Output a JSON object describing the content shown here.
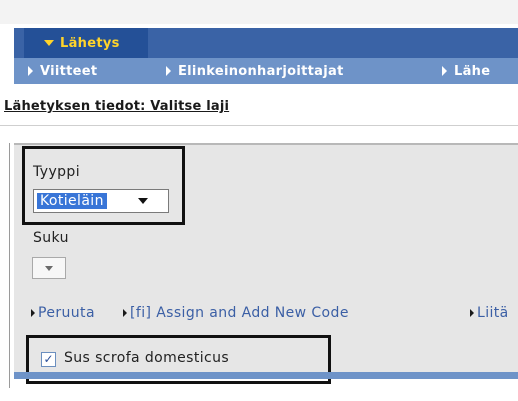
{
  "menu": {
    "active_label": "Lähetys",
    "sub_items": [
      "Viitteet",
      "Elinkeinonharjoittajat",
      "Lähe"
    ]
  },
  "section": {
    "title": "Lähetyksen tiedot: Valitse laji"
  },
  "form": {
    "tyyppi": {
      "label": "Tyyppi",
      "value": "Kotieläin"
    },
    "suku": {
      "label": "Suku",
      "value": ""
    }
  },
  "actions": [
    "Peruuta",
    "[fi] Assign and Add New Code",
    "Liitä"
  ],
  "species": {
    "label": "Sus scrofa domesticus",
    "checked": true,
    "check_mark": "✓"
  },
  "colors": {
    "menu_bar": "#3a63a6",
    "menu_active": "#245097",
    "menu_active_text": "#ffd42a",
    "sub_bar": "#6e93c8",
    "link": "#3b5fa5",
    "selection": "#3875d7"
  }
}
